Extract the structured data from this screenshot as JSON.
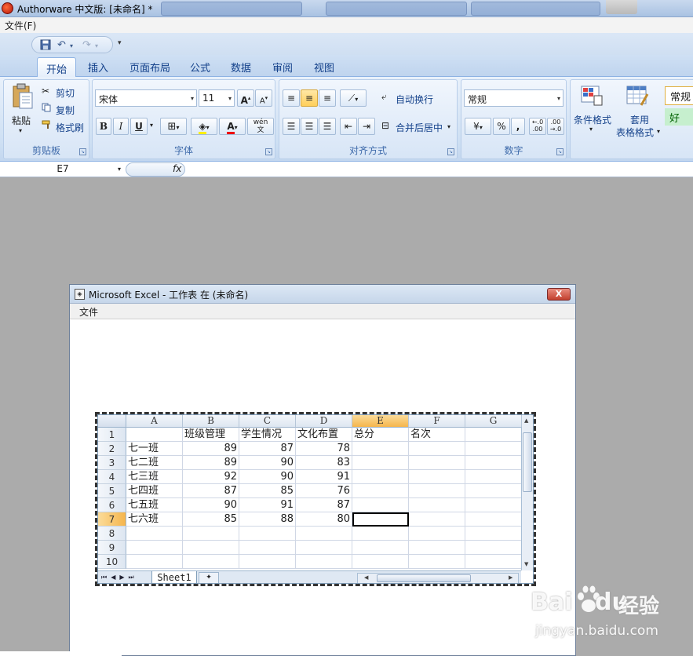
{
  "window": {
    "title": "Authorware 中文版: [未命名] *"
  },
  "menubar": {
    "file": "文件(F)"
  },
  "ribbon": {
    "tabs": [
      "开始",
      "插入",
      "页面布局",
      "公式",
      "数据",
      "审阅",
      "视图"
    ],
    "clipboard": {
      "paste": "粘贴",
      "cut": "剪切",
      "copy": "复制",
      "format_painter": "格式刷",
      "label": "剪贴板"
    },
    "font": {
      "name": "宋体",
      "size": "11",
      "bold": "B",
      "italic": "I",
      "underline": "U",
      "label": "字体"
    },
    "alignment": {
      "wrap_text": "自动换行",
      "merge_center": "合并后居中",
      "label": "对齐方式"
    },
    "number": {
      "format": "常规",
      "percent": "%",
      "comma": ",",
      "label": "数字"
    },
    "styles": {
      "conditional_format": "条件格式",
      "table_format_line1": "套用",
      "table_format_line2": "表格格式",
      "style_normal": "常规",
      "style_good": "好"
    }
  },
  "formula_bar": {
    "name_box": "E7",
    "fx": "fx",
    "value": ""
  },
  "dialog": {
    "title": "Microsoft Excel - 工作表 在 (未命名)",
    "menu_file": "文件",
    "close": "X"
  },
  "sheet": {
    "columns": [
      "A",
      "B",
      "C",
      "D",
      "E",
      "F",
      "G"
    ],
    "rows": [
      "1",
      "2",
      "3",
      "4",
      "5",
      "6",
      "7",
      "8",
      "9",
      "10"
    ],
    "headers": [
      "",
      "班级管理",
      "学生情况",
      "文化布置",
      "总分",
      "名次"
    ],
    "data": [
      [
        "七一班",
        "89",
        "87",
        "78"
      ],
      [
        "七二班",
        "89",
        "90",
        "83"
      ],
      [
        "七三班",
        "92",
        "90",
        "91"
      ],
      [
        "七四班",
        "87",
        "85",
        "76"
      ],
      [
        "七五班",
        "90",
        "91",
        "87"
      ],
      [
        "七六班",
        "85",
        "88",
        "80"
      ]
    ],
    "active_cell": "E7",
    "sheet_tab": "Sheet1"
  },
  "watermark": {
    "logo": "Bai",
    "logo_du": "du",
    "text": "经验",
    "url": "jingyan.baidu.com"
  },
  "colors": {
    "selected_header": "#f5b54c",
    "ribbon_blue": "#15428b",
    "good_style_bg": "#c6efce"
  }
}
